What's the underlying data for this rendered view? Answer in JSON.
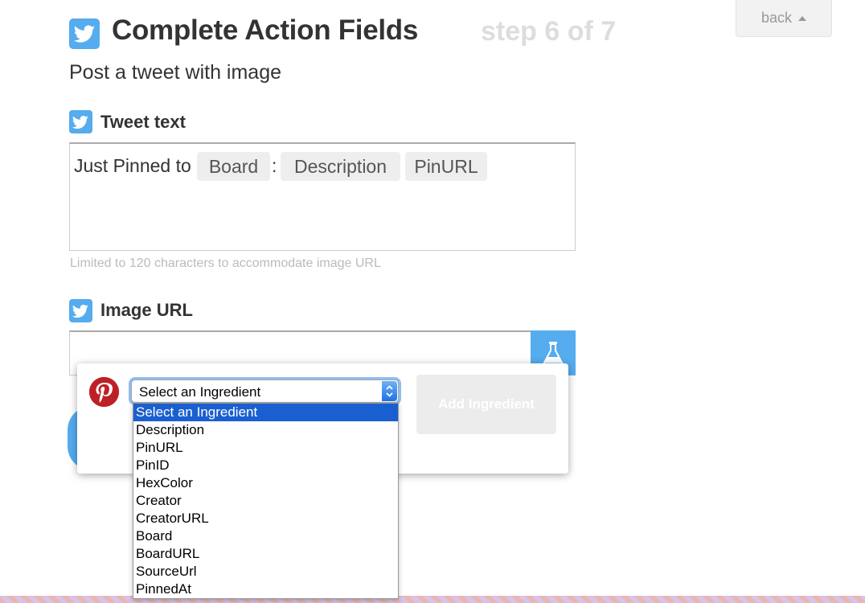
{
  "header": {
    "title": "Complete Action Fields",
    "step": "step 6 of 7",
    "back_label": "back",
    "subtitle": "Post a tweet with image"
  },
  "fields": {
    "tweet_text": {
      "label": "Tweet text",
      "value_prefix": "Just Pinned to",
      "separator": ":",
      "pills": [
        "Board",
        "Description",
        "PinURL"
      ],
      "hint": "Limited to 120 characters to accommodate image URL"
    },
    "image_url": {
      "label": "Image URL",
      "value": ""
    }
  },
  "ingredient_popup": {
    "service": "Pinterest",
    "select_value": "Select an Ingredient",
    "add_button_label": "Add Ingredient",
    "options": [
      "Select an Ingredient",
      "Description",
      "PinURL",
      "PinID",
      "HexColor",
      "Creator",
      "CreatorURL",
      "Board",
      "BoardURL",
      "SourceUrl",
      "PinnedAt"
    ],
    "selected_index": 0
  },
  "icons": {
    "field_service_icon": "twitter-icon",
    "ingredient_toggle_icon": "flask-icon",
    "popup_service_icon": "pinterest-logo-icon",
    "back_icon": "caret-up-icon"
  },
  "colors": {
    "twitter_blue": "#55acee",
    "pinterest_red": "#bd2126",
    "step_gray": "#dddddd",
    "selected_option": "#1a5fd0"
  }
}
